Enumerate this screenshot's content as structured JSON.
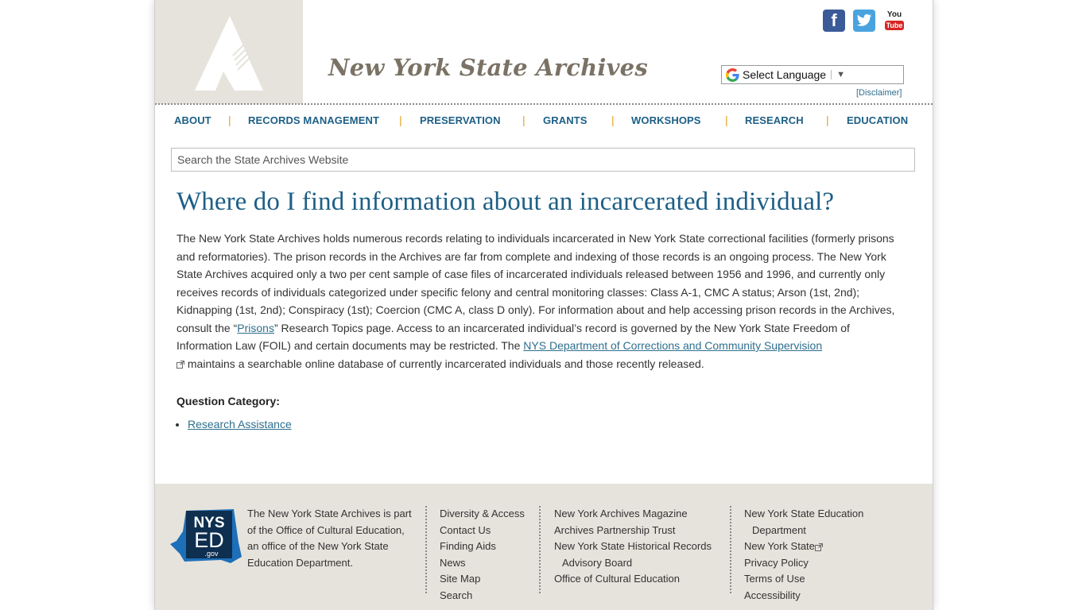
{
  "header": {
    "site_title": "New York State Archives",
    "social": {
      "facebook": "f",
      "youtube_top": "You",
      "youtube_bottom": "Tube"
    },
    "language_select": "Select Language",
    "disclaimer": "[Disclaimer]"
  },
  "nav": {
    "items": [
      "ABOUT",
      "RECORDS MANAGEMENT",
      "PRESERVATION",
      "GRANTS",
      "WORKSHOPS",
      "RESEARCH",
      "EDUCATION"
    ],
    "separator": "|"
  },
  "search": {
    "placeholder": "Search the State Archives Website"
  },
  "main": {
    "title": "Where do I find information about an incarcerated individual?",
    "body_part1": "The New York State Archives holds numerous records relating to individuals incarcerated in New York State correctional facilities (formerly prisons and reformatories). The prison records in the Archives are far from complete and indexing of those records is an ongoing process. The New York State Archives acquired only a two per cent sample of case files of incarcerated individuals released between 1956 and 1996, and currently only receives records of individuals categorized under specific felony and central monitoring classes: Class A-1, CMC A status; Arson (1st, 2nd); Kidnapping (1st, 2nd); Conspiracy (1st); Coercion (CMC A, class D only). For information about and help accessing prison records in the Archives, consult the “",
    "link_prisons": "Prisons",
    "body_part2": "” Research Topics page. Access to an incarcerated individual’s record is governed by the New York State Freedom of Information Law (FOIL) and certain documents may be restricted. The ",
    "link_docs": "NYS Department of Corrections and Community Supervision",
    "body_part3": " maintains a searchable online database of currently incarcerated individuals and those recently released.",
    "question_category_label": "Question Category:",
    "question_category_link": "Research Assistance"
  },
  "footer": {
    "logo": {
      "line1": "NYS",
      "line2": "ED",
      "line3": ".gov"
    },
    "about": "The New York State Archives is part of the Office of Cultural Education, an office of the New York State Education Department.",
    "col1": [
      "Diversity & Access",
      "Contact Us",
      "Finding Aids",
      "News",
      "Site Map",
      "Search"
    ],
    "col2": {
      "magazine": "New York Archives Magazine",
      "trust": "Archives Partnership Trust",
      "advisory_line1": "New York State Historical Records",
      "advisory_line2": "Advisory Board",
      "oce": "Office of Cultural Education"
    },
    "col3": {
      "nysed_line1": "New York State Education",
      "nysed_line2": "Department",
      "nys": "New York State",
      "privacy": "Privacy Policy",
      "terms": "Terms of Use",
      "accessibility": "Accessibility"
    }
  },
  "colors": {
    "accent_blue": "#1d5f86",
    "link": "#2e6f8e",
    "nav_separator": "#e0a323",
    "footer_bg": "#e6e3dc"
  }
}
